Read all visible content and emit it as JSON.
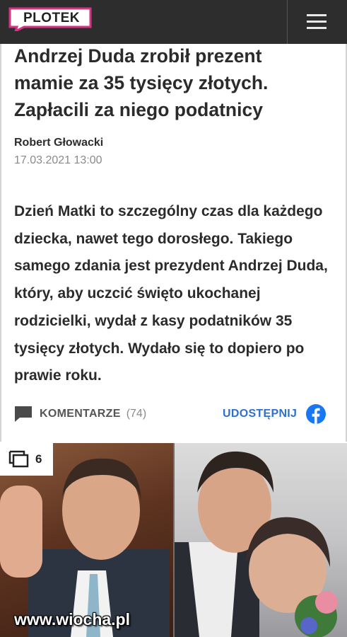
{
  "header": {
    "logo_text": "PLOTEK",
    "logo_color": "#d63384",
    "bar_color": "#2d2d2d",
    "menu_icon": "hamburger-menu-icon"
  },
  "article": {
    "title": "Andrzej Duda zrobił prezent mamie za 35 tysięcy złotych. Zapłacili za niego podatnicy",
    "author": "Robert Głowacki",
    "date": "17.03.2021 13:00",
    "lead": "Dzień Matki to szczególny czas dla każdego dziecka, nawet tego dorosłego. Takiego samego zdania jest prezydent Andrzej Duda, który, aby uczcić święto ukochanej rodzicielki, wydał z kasy podatników 35 tysięcy złotych. Wydało się to dopiero po prawie roku."
  },
  "actions": {
    "comments_label": "KOMENTARZE",
    "comments_count": "(74)",
    "comment_icon": "comment-bubble-icon",
    "share_label": "UDOSTĘPNIJ",
    "share_icon": "facebook-icon",
    "share_color": "#2e6fd0"
  },
  "gallery": {
    "count": "6",
    "count_icon": "gallery-stack-icon"
  },
  "watermark": "www.wiocha.pl"
}
